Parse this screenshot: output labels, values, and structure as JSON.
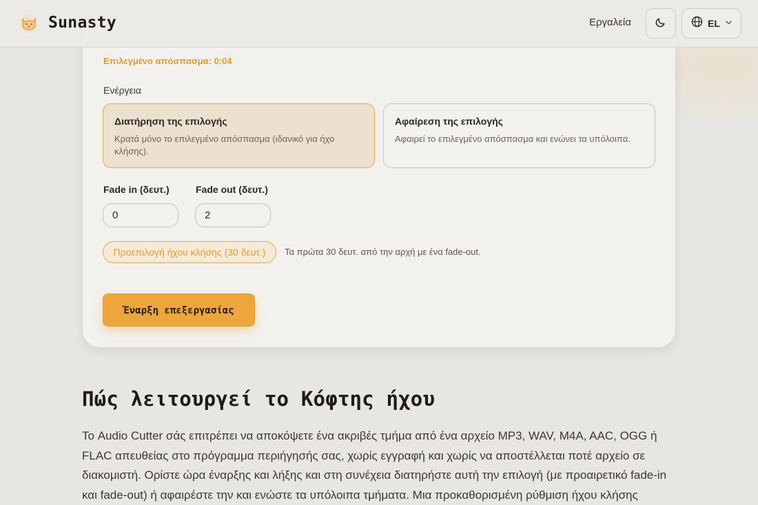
{
  "header": {
    "brand": "Sunasty",
    "tools_link": "Εργαλεία",
    "language_code": "EL",
    "icons": {
      "logo": "cat-logo-icon",
      "theme": "moon-icon",
      "language": "globe-icon",
      "dropdown": "chevron-down-icon"
    }
  },
  "editor": {
    "selected_clip_label": "Επιλεγμένο απόσπασμα: 0:04",
    "action_label": "Ενέργεια",
    "actions": [
      {
        "title": "Διατήρηση της επιλογής",
        "description": "Κρατά μόνο το επιλεγμένο απόσπασμα (ιδανικό για ήχο κλήσης).",
        "selected": true
      },
      {
        "title": "Αφαίρεση της επιλογής",
        "description": "Αφαιρεί το επιλεγμένο απόσπασμα και ενώνει τα υπόλοιπα.",
        "selected": false
      }
    ],
    "fade_in_label": "Fade in (δευτ.)",
    "fade_in_value": "0",
    "fade_out_label": "Fade out (δευτ.)",
    "fade_out_value": "2",
    "preset_button": "Προεπιλογή ήχου κλήσης (30 δευτ.)",
    "preset_note": "Τα πρώτα 30 δευτ. από την αρχή με ένα fade-out.",
    "process_button": "Έναρξη επεξεργασίας"
  },
  "how_it_works": {
    "title": "Πώς λειτουργεί το Κόφτης ήχου",
    "body": "Το Audio Cutter σάς επιτρέπει να αποκόψετε ένα ακριβές τμήμα από ένα αρχείο MP3, WAV, M4A, AAC, OGG ή FLAC απευθείας στο πρόγραμμα περιήγησής σας, χωρίς εγγραφή και χωρίς να αποστέλλεται ποτέ αρχείο σε διακομιστή. Ορίστε ώρα έναρξης και λήξης και στη συνέχεια διατηρήστε αυτή την επιλογή (με προαιρετικό fade-in και fade-out) ή αφαιρέστε την και ενώστε τα υπόλοιπα τμήματα. Μια προκαθορισμένη ρύθμιση ήχου κλήσης"
  },
  "colors": {
    "accent": "#eca63d",
    "accent_text": "#e29a2e",
    "background": "#e8e6e2",
    "card": "#f3f1ed"
  }
}
